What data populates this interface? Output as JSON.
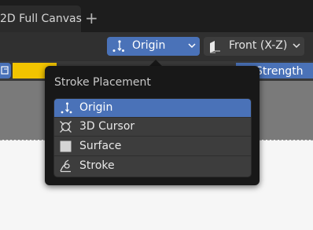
{
  "tabs": {
    "workspace_label": "2D Full Canvas",
    "add_label": "+"
  },
  "header": {
    "placement_dropdown": {
      "icon": "origin-icon",
      "label": "Origin"
    },
    "view_dropdown": {
      "icon": "canvas-plane-icon",
      "label": "Front (X-Z)"
    }
  },
  "tool_settings": {
    "strength_label": "Strength",
    "swatch_color": "#f2c400"
  },
  "popup": {
    "title": "Stroke Placement",
    "items": [
      {
        "icon": "origin-icon",
        "label": "Origin",
        "selected": true
      },
      {
        "icon": "3d-cursor-icon",
        "label": "3D Cursor",
        "selected": false
      },
      {
        "icon": "surface-icon",
        "label": "Surface",
        "selected": false
      },
      {
        "icon": "stroke-icon",
        "label": "Stroke",
        "selected": false
      }
    ]
  },
  "colors": {
    "accent": "#4a72b8",
    "popup_bg": "#181818",
    "item_bg": "#3d3d3d"
  }
}
